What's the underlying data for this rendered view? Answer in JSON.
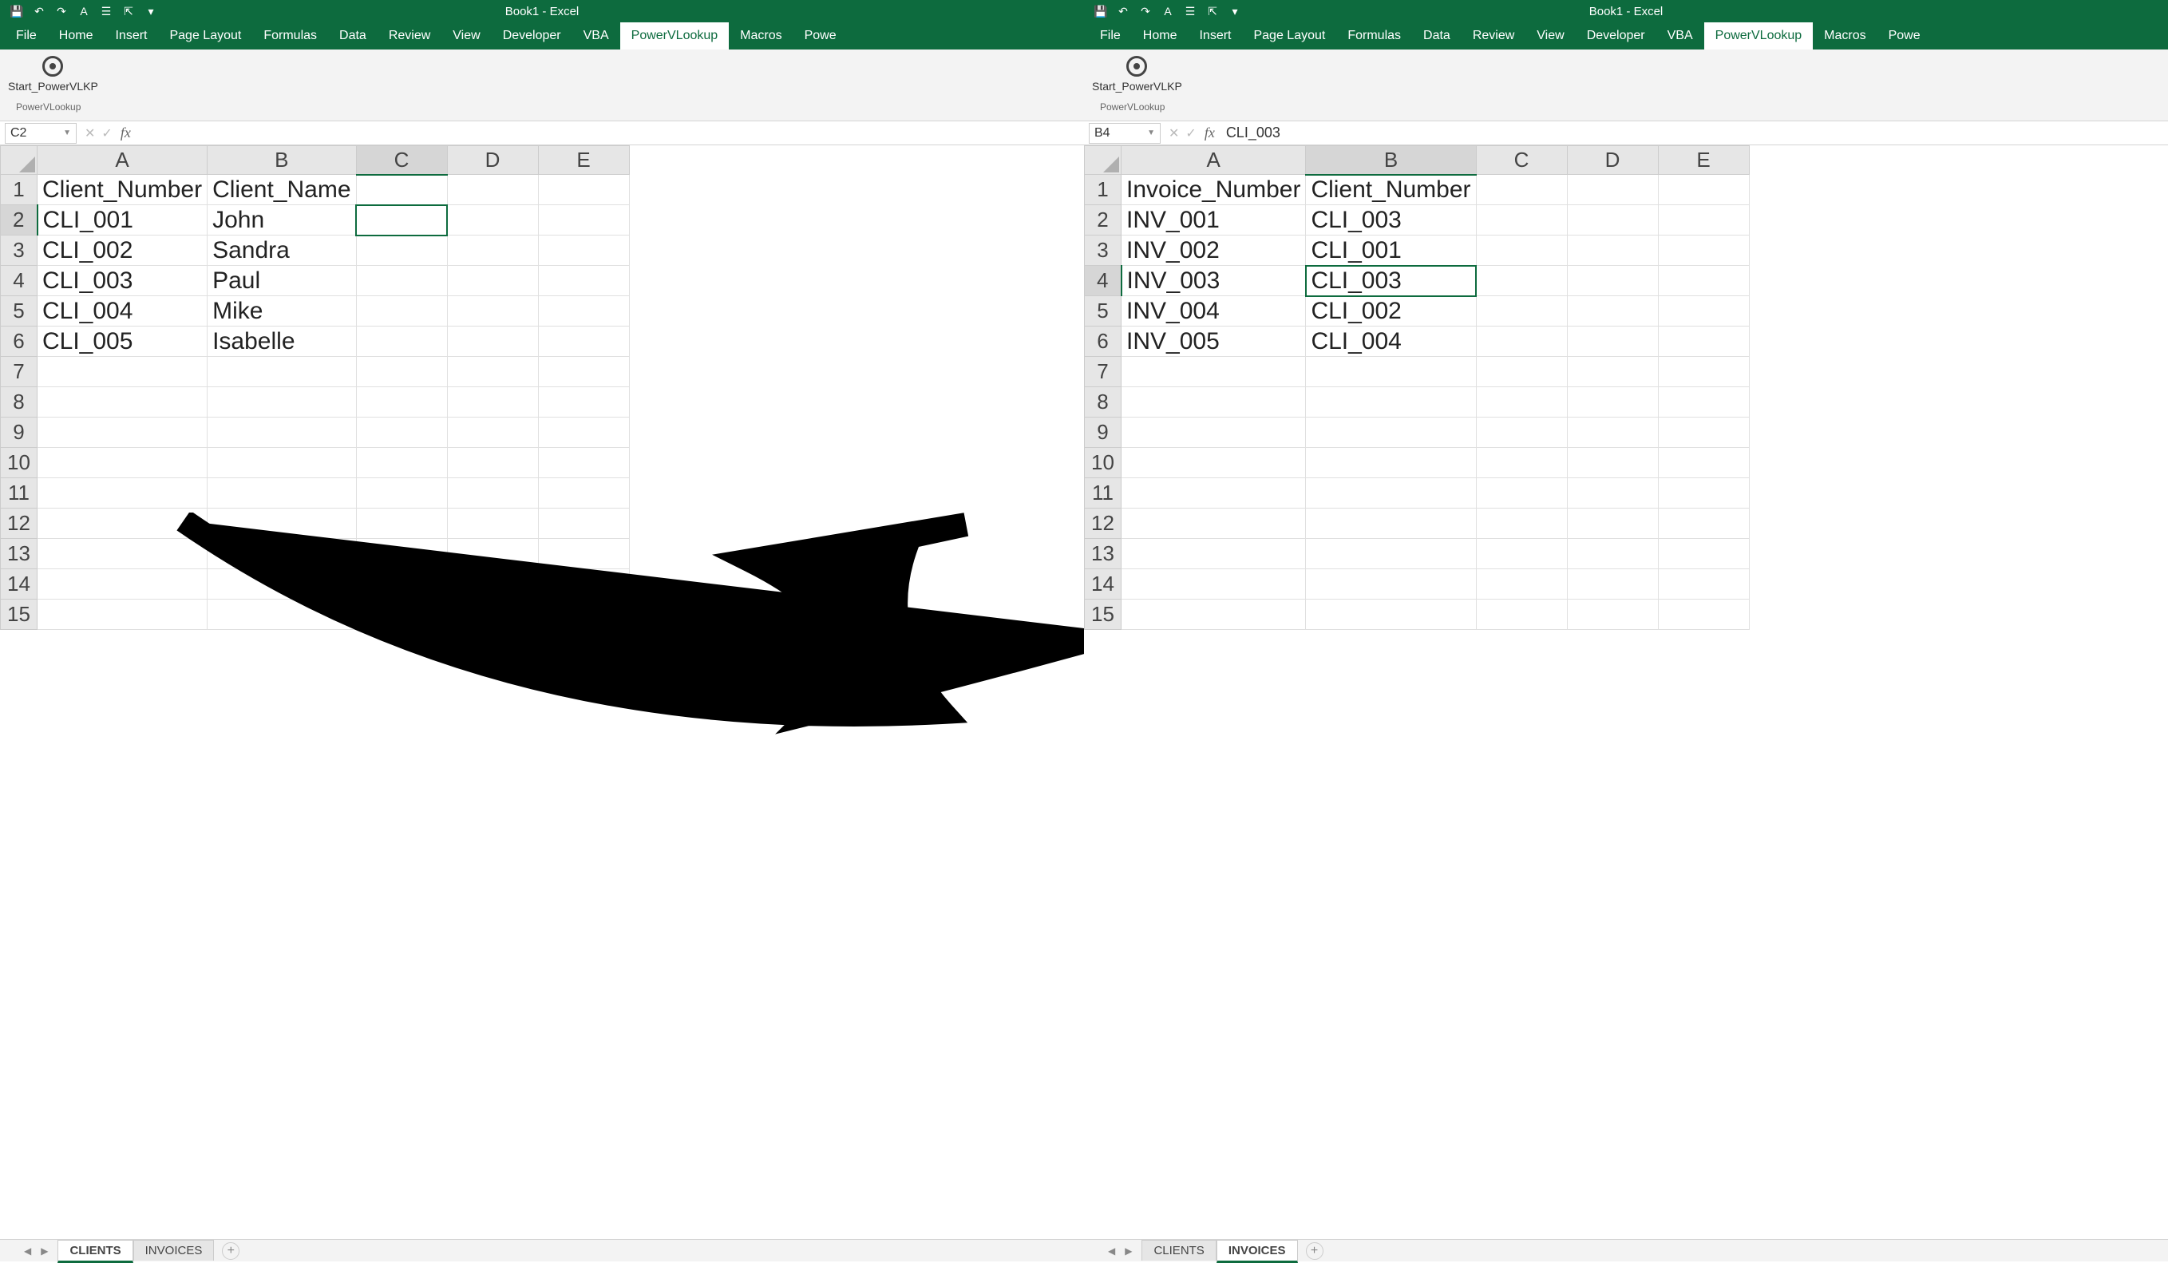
{
  "left": {
    "title": "Book1  -  Excel",
    "tabs": [
      "File",
      "Home",
      "Insert",
      "Page Layout",
      "Formulas",
      "Data",
      "Review",
      "View",
      "Developer",
      "VBA",
      "PowerVLookup",
      "Macros",
      "Powe"
    ],
    "active_tab": "PowerVLookup",
    "ribbon_btn": "Start_PowerVLKP",
    "ribbon_group": "PowerVLookup",
    "name_box": "C2",
    "formula_value": "",
    "columns": [
      "A",
      "B",
      "C",
      "D",
      "E"
    ],
    "rows": [
      {
        "n": "1",
        "cells": [
          "Client_Number",
          "Client_Name",
          "",
          "",
          ""
        ]
      },
      {
        "n": "2",
        "cells": [
          "CLI_001",
          "John",
          "",
          "",
          ""
        ]
      },
      {
        "n": "3",
        "cells": [
          "CLI_002",
          "Sandra",
          "",
          "",
          ""
        ]
      },
      {
        "n": "4",
        "cells": [
          "CLI_003",
          "Paul",
          "",
          "",
          ""
        ]
      },
      {
        "n": "5",
        "cells": [
          "CLI_004",
          "Mike",
          "",
          "",
          ""
        ]
      },
      {
        "n": "6",
        "cells": [
          "CLI_005",
          "Isabelle",
          "",
          "",
          ""
        ]
      },
      {
        "n": "7",
        "cells": [
          "",
          "",
          "",
          "",
          ""
        ]
      },
      {
        "n": "8",
        "cells": [
          "",
          "",
          "",
          "",
          ""
        ]
      },
      {
        "n": "9",
        "cells": [
          "",
          "",
          "",
          "",
          ""
        ]
      },
      {
        "n": "10",
        "cells": [
          "",
          "",
          "",
          "",
          ""
        ]
      },
      {
        "n": "11",
        "cells": [
          "",
          "",
          "",
          "",
          ""
        ]
      },
      {
        "n": "12",
        "cells": [
          "",
          "",
          "",
          "",
          ""
        ]
      },
      {
        "n": "13",
        "cells": [
          "",
          "",
          "",
          "",
          ""
        ]
      },
      {
        "n": "14",
        "cells": [
          "",
          "",
          "",
          "",
          ""
        ]
      },
      {
        "n": "15",
        "cells": [
          "",
          "",
          "",
          "",
          ""
        ]
      }
    ],
    "sel_col": 2,
    "sel_row": 1,
    "sheets": [
      "CLIENTS",
      "INVOICES"
    ],
    "active_sheet": "CLIENTS"
  },
  "right": {
    "title": "Book1  -  Excel",
    "tabs": [
      "File",
      "Home",
      "Insert",
      "Page Layout",
      "Formulas",
      "Data",
      "Review",
      "View",
      "Developer",
      "VBA",
      "PowerVLookup",
      "Macros",
      "Powe"
    ],
    "active_tab": "PowerVLookup",
    "ribbon_btn": "Start_PowerVLKP",
    "ribbon_group": "PowerVLookup",
    "name_box": "B4",
    "formula_value": "CLI_003",
    "columns": [
      "A",
      "B",
      "C",
      "D",
      "E"
    ],
    "rows": [
      {
        "n": "1",
        "cells": [
          "Invoice_Number",
          "Client_Number",
          "",
          "",
          ""
        ]
      },
      {
        "n": "2",
        "cells": [
          "INV_001",
          "CLI_003",
          "",
          "",
          ""
        ]
      },
      {
        "n": "3",
        "cells": [
          "INV_002",
          "CLI_001",
          "",
          "",
          ""
        ]
      },
      {
        "n": "4",
        "cells": [
          "INV_003",
          "CLI_003",
          "",
          "",
          ""
        ]
      },
      {
        "n": "5",
        "cells": [
          "INV_004",
          "CLI_002",
          "",
          "",
          ""
        ]
      },
      {
        "n": "6",
        "cells": [
          "INV_005",
          "CLI_004",
          "",
          "",
          ""
        ]
      },
      {
        "n": "7",
        "cells": [
          "",
          "",
          "",
          "",
          ""
        ]
      },
      {
        "n": "8",
        "cells": [
          "",
          "",
          "",
          "",
          ""
        ]
      },
      {
        "n": "9",
        "cells": [
          "",
          "",
          "",
          "",
          ""
        ]
      },
      {
        "n": "10",
        "cells": [
          "",
          "",
          "",
          "",
          ""
        ]
      },
      {
        "n": "11",
        "cells": [
          "",
          "",
          "",
          "",
          ""
        ]
      },
      {
        "n": "12",
        "cells": [
          "",
          "",
          "",
          "",
          ""
        ]
      },
      {
        "n": "13",
        "cells": [
          "",
          "",
          "",
          "",
          ""
        ]
      },
      {
        "n": "14",
        "cells": [
          "",
          "",
          "",
          "",
          ""
        ]
      },
      {
        "n": "15",
        "cells": [
          "",
          "",
          "",
          "",
          ""
        ]
      }
    ],
    "sel_col": 1,
    "sel_row": 3,
    "sheets": [
      "CLIENTS",
      "INVOICES"
    ],
    "active_sheet": "INVOICES"
  },
  "qat_icons": [
    "save-icon",
    "undo-icon",
    "redo-icon",
    "font-icon",
    "touch-icon",
    "dropdown-icon",
    "more-icon"
  ]
}
